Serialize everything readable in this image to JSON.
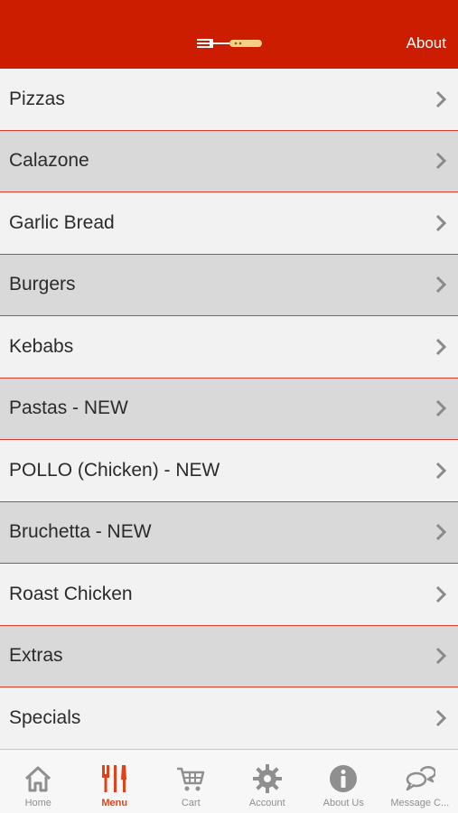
{
  "header": {
    "logo_icon": "fork-knife-logo-icon",
    "about_label": "About",
    "background_color": "#cc1d00"
  },
  "menu": {
    "items": [
      {
        "label": "Pizzas"
      },
      {
        "label": "Calazone"
      },
      {
        "label": "Garlic Bread"
      },
      {
        "label": "Burgers"
      },
      {
        "label": "Kebabs"
      },
      {
        "label": "Pastas - NEW"
      },
      {
        "label": "POLLO (Chicken) - NEW"
      },
      {
        "label": "Bruchetta - NEW"
      },
      {
        "label": "Roast Chicken"
      },
      {
        "label": "Extras"
      },
      {
        "label": "Specials"
      }
    ],
    "separator_color": "#d83c2b"
  },
  "tabbar": {
    "active_color": "#e2421a",
    "tabs": [
      {
        "label": "Home",
        "icon": "home-icon",
        "active": false
      },
      {
        "label": "Menu",
        "icon": "fork-knife-icon",
        "active": true
      },
      {
        "label": "Cart",
        "icon": "cart-icon",
        "active": false
      },
      {
        "label": "Account",
        "icon": "gear-icon",
        "active": false
      },
      {
        "label": "About Us",
        "icon": "info-icon",
        "active": false
      },
      {
        "label": "Message C...",
        "icon": "chat-bubbles-icon",
        "active": false
      }
    ]
  }
}
